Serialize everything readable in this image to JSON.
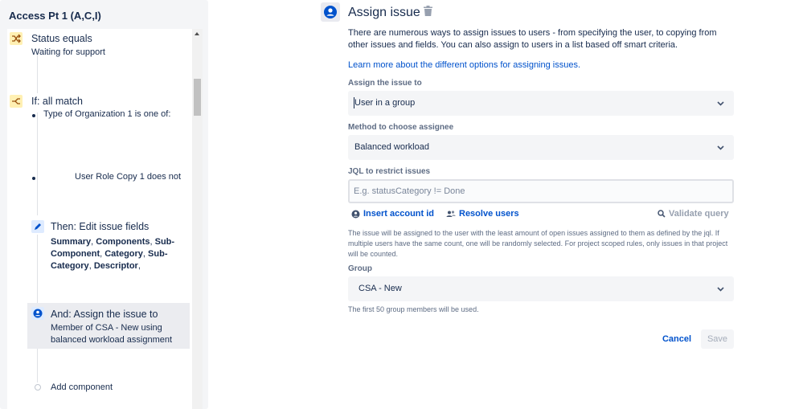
{
  "left": {
    "title": "Access Pt 1 (A,C,I)",
    "condition": {
      "title": "Status equals",
      "subtitle": "Waiting for support"
    },
    "branch": {
      "title": "If: all match",
      "bullet1": "Type of Organization 1 is one of:",
      "bullet2": "User Role Copy 1 does not"
    },
    "edit": {
      "title": "Then: Edit issue fields",
      "f1": "Summary",
      "sep1": ", ",
      "f2": "Components",
      "sep2": ", ",
      "f3": "Sub-Component",
      "sep3": ", ",
      "f4": "Category",
      "sep4": ", ",
      "f5": "Sub-Category",
      "sep5": ", ",
      "f6": "Descriptor",
      "sep6": ","
    },
    "assign": {
      "title": "And: Assign the issue to",
      "line1": "Member of CSA - New using",
      "line2": "balanced workload assignment"
    },
    "add_component": "Add component"
  },
  "config": {
    "title": "Assign issue",
    "description": "There are numerous ways to assign issues to users - from specifying the user, to copying from other issues and fields. You can also assign to users in a list based off smart criteria.",
    "learn_link": "Learn more about the different options for assigning issues.",
    "assign_label": "Assign the issue to",
    "assign_value": "User in a group",
    "method_label": "Method to choose assignee",
    "method_value": "Balanced workload",
    "jql_label": "JQL to restrict issues",
    "jql_placeholder": "E.g. statusCategory != Done",
    "insert_account": "Insert account id",
    "resolve_users": "Resolve users",
    "validate_query": "Validate query",
    "jql_help": "The issue will be assigned to the user with the least amount of open issues assigned to them as defined by the jql. If multiple users have the same count, one will be randomly selected. For project scoped rules, only issues in that project will be counted.",
    "group_label": "Group",
    "group_value": "CSA - New",
    "group_help": "The first 50 group members will be used.",
    "cancel": "Cancel",
    "save": "Save"
  },
  "colors": {
    "link": "#0052cc",
    "condition_icon": "#fff0b3",
    "action_icon": "#deebff",
    "text": "#172b4d"
  }
}
